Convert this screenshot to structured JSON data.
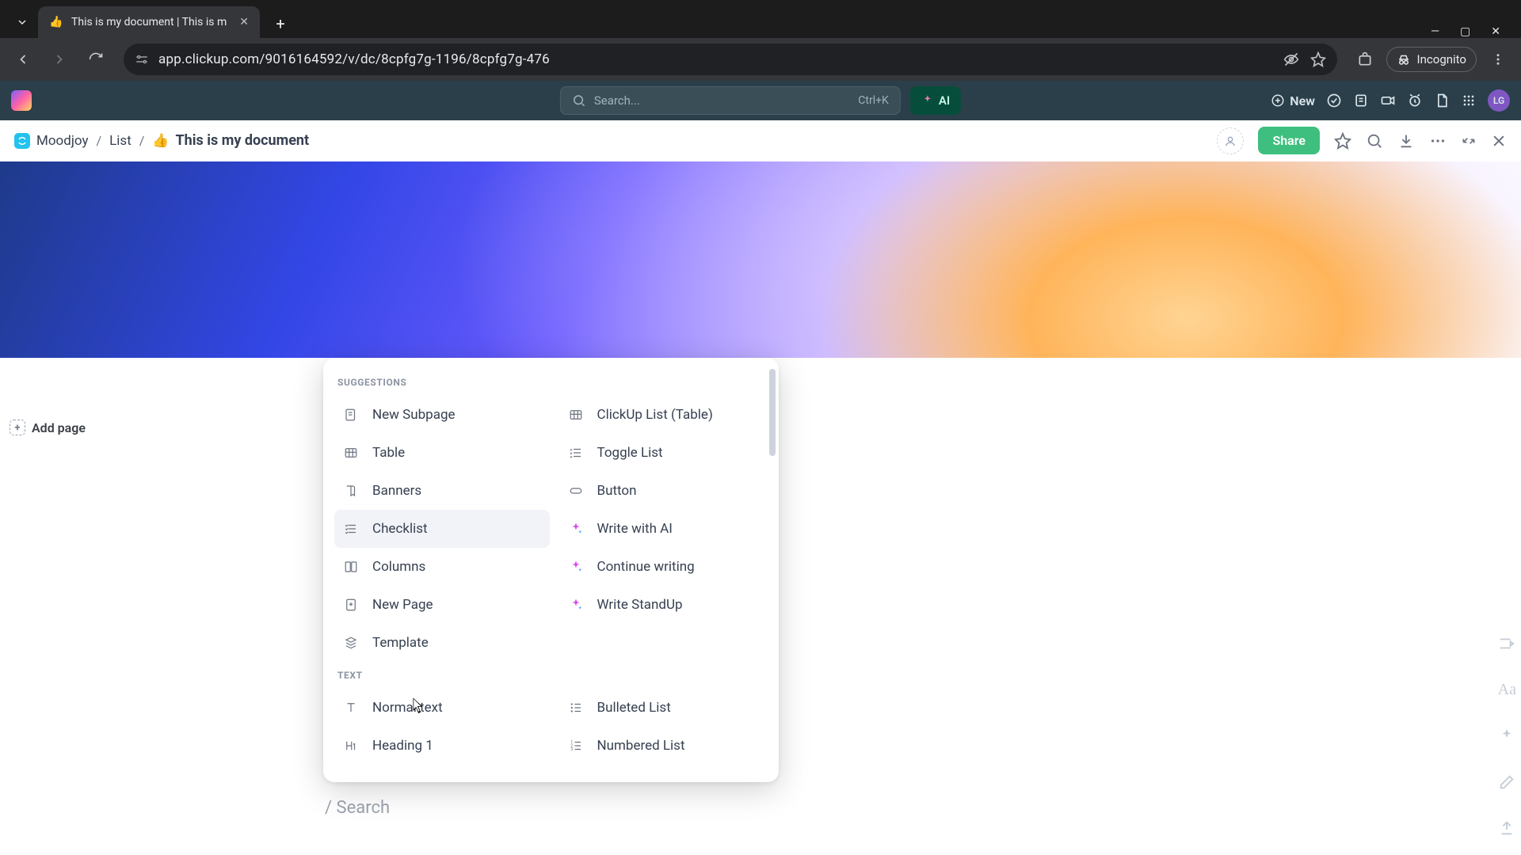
{
  "browser": {
    "tab_title": "This is my document | This is m",
    "favicon": "👍",
    "url": "app.clickup.com/9016164592/v/dc/8cpfg7g-1196/8cpfg7g-476",
    "incognito_label": "Incognito"
  },
  "app_header": {
    "search_placeholder": "Search...",
    "search_shortcut": "Ctrl+K",
    "ai_label": "AI",
    "new_label": "New",
    "avatar_initials": "LG"
  },
  "breadcrumb": {
    "workspace": "Moodjoy",
    "list": "List",
    "doc_emoji": "👍",
    "doc_title": "This is my document",
    "share_label": "Share"
  },
  "doc_sidebar": {
    "add_page_label": "Add page"
  },
  "doc_body": {
    "slash_hint": "/ Search"
  },
  "slash_menu": {
    "section_suggestions": "SUGGESTIONS",
    "section_text": "TEXT",
    "suggestions_left": [
      {
        "label": "New Subpage",
        "icon": "subpage"
      },
      {
        "label": "Table",
        "icon": "table"
      },
      {
        "label": "Banners",
        "icon": "banner"
      },
      {
        "label": "Checklist",
        "icon": "checklist"
      },
      {
        "label": "Columns",
        "icon": "columns"
      },
      {
        "label": "New Page",
        "icon": "newpage"
      },
      {
        "label": "Template",
        "icon": "template"
      }
    ],
    "suggestions_right": [
      {
        "label": "ClickUp List (Table)",
        "icon": "table"
      },
      {
        "label": "Toggle List",
        "icon": "toggle"
      },
      {
        "label": "Button",
        "icon": "button"
      },
      {
        "label": "Write with AI",
        "icon": "ai"
      },
      {
        "label": "Continue writing",
        "icon": "ai"
      },
      {
        "label": "Write StandUp",
        "icon": "ai"
      }
    ],
    "text_left": [
      {
        "label": "Normal text",
        "icon": "text"
      },
      {
        "label": "Heading 1",
        "icon": "h1"
      }
    ],
    "text_right": [
      {
        "label": "Bulleted List",
        "icon": "bulleted"
      },
      {
        "label": "Numbered List",
        "icon": "numbered"
      }
    ],
    "hovered_label": "Checklist"
  }
}
